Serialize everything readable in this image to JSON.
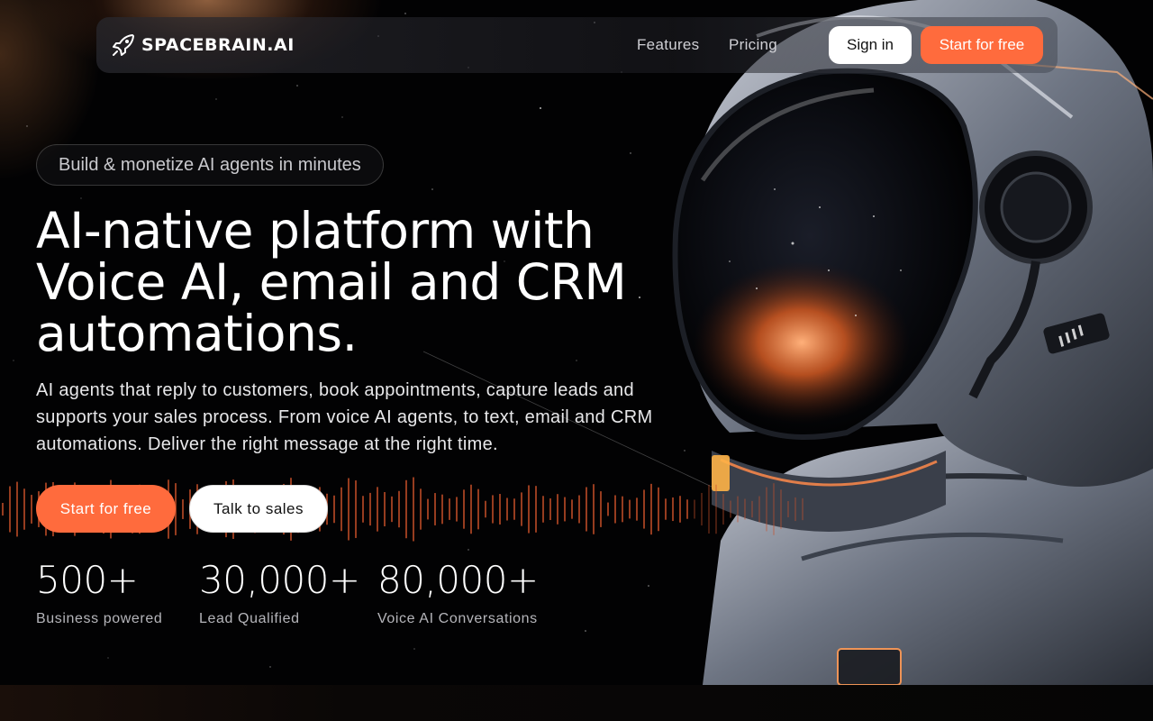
{
  "brand": {
    "name": "SPACEBRAIN.AI"
  },
  "nav": {
    "links": [
      {
        "label": "Features"
      },
      {
        "label": "Pricing"
      }
    ],
    "signin_label": "Sign in",
    "start_label": "Start for free"
  },
  "hero": {
    "badge": "Build & monetize AI agents in minutes",
    "headline_lines": [
      "AI-native platform with",
      "Voice AI, email and CRM",
      "automations."
    ],
    "subtext": "AI agents that reply to customers, book appointments, capture leads and supports your sales process. From voice AI agents, to text, email and CRM automations. Deliver the right message at the right time.",
    "cta_primary": "Start for free",
    "cta_secondary": "Talk to sales"
  },
  "stats": [
    {
      "value": "500+",
      "label": "Business powered"
    },
    {
      "value": "30,000+",
      "label": "Lead Qualified"
    },
    {
      "value": "80,000+",
      "label": "Voice AI Conversations"
    }
  ],
  "colors": {
    "accent": "#ff6b3d",
    "background": "#020203",
    "text": "#ffffff"
  },
  "icons": {
    "logo": "rocket-icon"
  }
}
